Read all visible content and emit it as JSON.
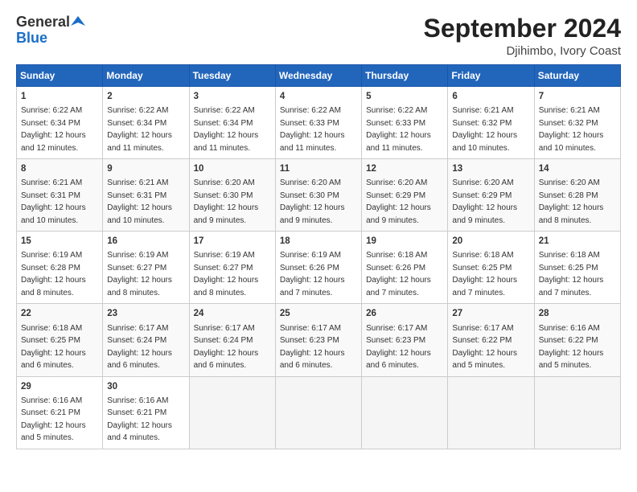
{
  "header": {
    "logo_general": "General",
    "logo_blue": "Blue",
    "month_title": "September 2024",
    "location": "Djihimbo, Ivory Coast"
  },
  "calendar": {
    "days_of_week": [
      "Sunday",
      "Monday",
      "Tuesday",
      "Wednesday",
      "Thursday",
      "Friday",
      "Saturday"
    ],
    "weeks": [
      [
        {
          "day": "",
          "empty": true
        },
        {
          "day": "",
          "empty": true
        },
        {
          "day": "",
          "empty": true
        },
        {
          "day": "",
          "empty": true
        },
        {
          "day": "",
          "empty": true
        },
        {
          "day": "",
          "empty": true
        },
        {
          "day": "",
          "empty": true
        }
      ],
      [
        {
          "day": "1",
          "sunrise": "6:22 AM",
          "sunset": "6:34 PM",
          "daylight": "12 hours and 12 minutes."
        },
        {
          "day": "2",
          "sunrise": "6:22 AM",
          "sunset": "6:34 PM",
          "daylight": "12 hours and 11 minutes."
        },
        {
          "day": "3",
          "sunrise": "6:22 AM",
          "sunset": "6:34 PM",
          "daylight": "12 hours and 11 minutes."
        },
        {
          "day": "4",
          "sunrise": "6:22 AM",
          "sunset": "6:33 PM",
          "daylight": "12 hours and 11 minutes."
        },
        {
          "day": "5",
          "sunrise": "6:22 AM",
          "sunset": "6:33 PM",
          "daylight": "12 hours and 11 minutes."
        },
        {
          "day": "6",
          "sunrise": "6:21 AM",
          "sunset": "6:32 PM",
          "daylight": "12 hours and 10 minutes."
        },
        {
          "day": "7",
          "sunrise": "6:21 AM",
          "sunset": "6:32 PM",
          "daylight": "12 hours and 10 minutes."
        }
      ],
      [
        {
          "day": "8",
          "sunrise": "6:21 AM",
          "sunset": "6:31 PM",
          "daylight": "12 hours and 10 minutes."
        },
        {
          "day": "9",
          "sunrise": "6:21 AM",
          "sunset": "6:31 PM",
          "daylight": "12 hours and 10 minutes."
        },
        {
          "day": "10",
          "sunrise": "6:20 AM",
          "sunset": "6:30 PM",
          "daylight": "12 hours and 9 minutes."
        },
        {
          "day": "11",
          "sunrise": "6:20 AM",
          "sunset": "6:30 PM",
          "daylight": "12 hours and 9 minutes."
        },
        {
          "day": "12",
          "sunrise": "6:20 AM",
          "sunset": "6:29 PM",
          "daylight": "12 hours and 9 minutes."
        },
        {
          "day": "13",
          "sunrise": "6:20 AM",
          "sunset": "6:29 PM",
          "daylight": "12 hours and 9 minutes."
        },
        {
          "day": "14",
          "sunrise": "6:20 AM",
          "sunset": "6:28 PM",
          "daylight": "12 hours and 8 minutes."
        }
      ],
      [
        {
          "day": "15",
          "sunrise": "6:19 AM",
          "sunset": "6:28 PM",
          "daylight": "12 hours and 8 minutes."
        },
        {
          "day": "16",
          "sunrise": "6:19 AM",
          "sunset": "6:27 PM",
          "daylight": "12 hours and 8 minutes."
        },
        {
          "day": "17",
          "sunrise": "6:19 AM",
          "sunset": "6:27 PM",
          "daylight": "12 hours and 8 minutes."
        },
        {
          "day": "18",
          "sunrise": "6:19 AM",
          "sunset": "6:26 PM",
          "daylight": "12 hours and 7 minutes."
        },
        {
          "day": "19",
          "sunrise": "6:18 AM",
          "sunset": "6:26 PM",
          "daylight": "12 hours and 7 minutes."
        },
        {
          "day": "20",
          "sunrise": "6:18 AM",
          "sunset": "6:25 PM",
          "daylight": "12 hours and 7 minutes."
        },
        {
          "day": "21",
          "sunrise": "6:18 AM",
          "sunset": "6:25 PM",
          "daylight": "12 hours and 7 minutes."
        }
      ],
      [
        {
          "day": "22",
          "sunrise": "6:18 AM",
          "sunset": "6:25 PM",
          "daylight": "12 hours and 6 minutes."
        },
        {
          "day": "23",
          "sunrise": "6:17 AM",
          "sunset": "6:24 PM",
          "daylight": "12 hours and 6 minutes."
        },
        {
          "day": "24",
          "sunrise": "6:17 AM",
          "sunset": "6:24 PM",
          "daylight": "12 hours and 6 minutes."
        },
        {
          "day": "25",
          "sunrise": "6:17 AM",
          "sunset": "6:23 PM",
          "daylight": "12 hours and 6 minutes."
        },
        {
          "day": "26",
          "sunrise": "6:17 AM",
          "sunset": "6:23 PM",
          "daylight": "12 hours and 6 minutes."
        },
        {
          "day": "27",
          "sunrise": "6:17 AM",
          "sunset": "6:22 PM",
          "daylight": "12 hours and 5 minutes."
        },
        {
          "day": "28",
          "sunrise": "6:16 AM",
          "sunset": "6:22 PM",
          "daylight": "12 hours and 5 minutes."
        }
      ],
      [
        {
          "day": "29",
          "sunrise": "6:16 AM",
          "sunset": "6:21 PM",
          "daylight": "12 hours and 5 minutes."
        },
        {
          "day": "30",
          "sunrise": "6:16 AM",
          "sunset": "6:21 PM",
          "daylight": "12 hours and 4 minutes."
        },
        {
          "day": "",
          "empty": true
        },
        {
          "day": "",
          "empty": true
        },
        {
          "day": "",
          "empty": true
        },
        {
          "day": "",
          "empty": true
        },
        {
          "day": "",
          "empty": true
        }
      ]
    ]
  }
}
